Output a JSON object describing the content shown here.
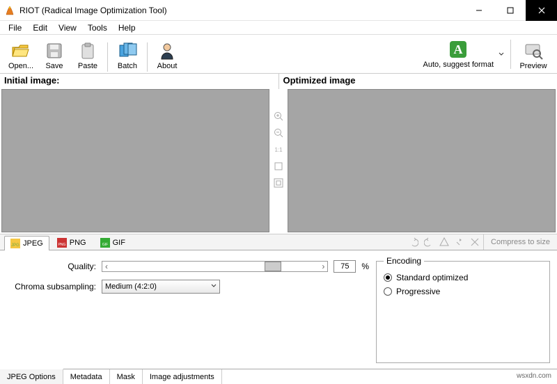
{
  "window": {
    "title": "RIOT (Radical Image Optimization Tool)"
  },
  "menu": [
    "File",
    "Edit",
    "View",
    "Tools",
    "Help"
  ],
  "toolbar": {
    "open": "Open...",
    "save": "Save",
    "paste": "Paste",
    "batch": "Batch",
    "about": "About",
    "auto": "Auto, suggest format",
    "preview": "Preview"
  },
  "panels": {
    "initial": "Initial image:",
    "optimized": "Optimized image"
  },
  "center_tools": {
    "zoom_ratio": "1:1"
  },
  "format_tabs": {
    "jpeg": "JPEG",
    "png": "PNG",
    "gif": "GIF",
    "compress": "Compress to size"
  },
  "settings": {
    "quality_label": "Quality:",
    "quality_value": "75",
    "quality_unit": "%",
    "chroma_label": "Chroma subsampling:",
    "chroma_value": "Medium (4:2:0)",
    "encoding_legend": "Encoding",
    "encoding_standard": "Standard optimized",
    "encoding_progressive": "Progressive"
  },
  "bottom_tabs": [
    "JPEG Options",
    "Metadata",
    "Mask",
    "Image adjustments"
  ],
  "watermark": "wsxdn.com"
}
